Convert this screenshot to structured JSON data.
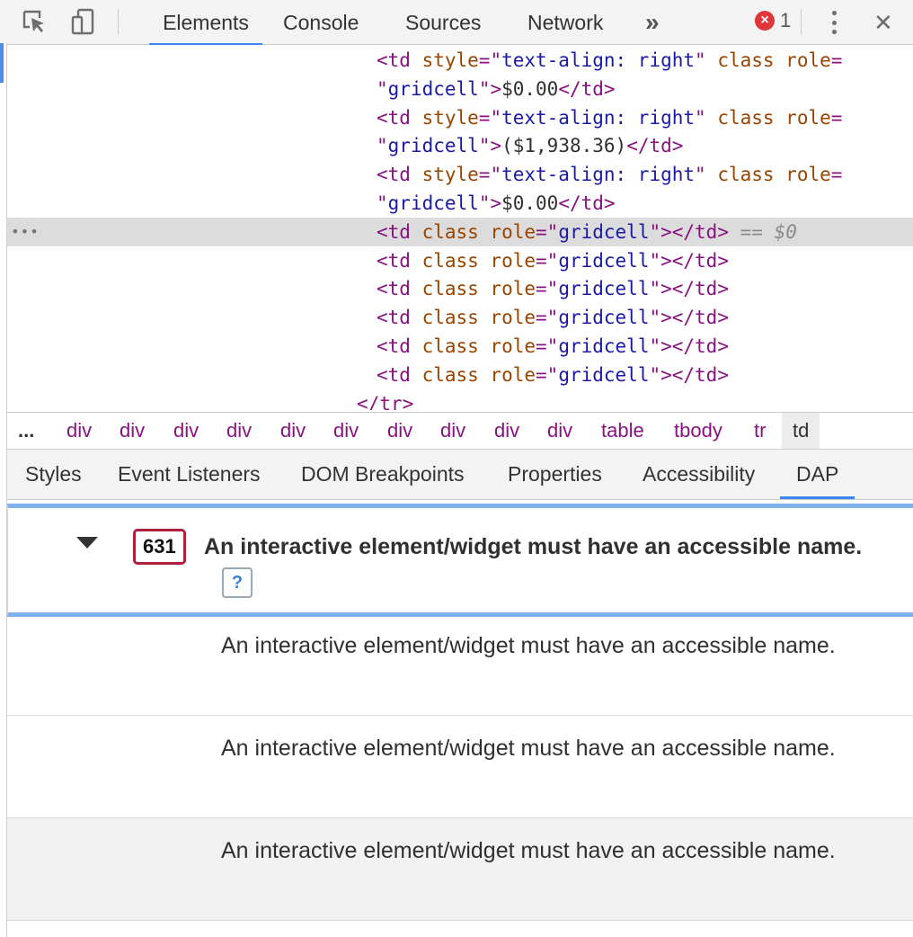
{
  "toolbar": {
    "icons": [
      "inspect-element-icon",
      "device-toolbar-icon"
    ],
    "tabs": [
      "Elements",
      "Console",
      "Sources",
      "Network"
    ],
    "more_tabs_glyph": "»",
    "error_count": "1",
    "error_glyph": "×",
    "close_glyph": "✕"
  },
  "dom": {
    "lines": [
      {
        "indent": true,
        "parts": [
          [
            "tag",
            "<td "
          ],
          [
            "attr",
            "style"
          ],
          [
            "tag",
            "=\""
          ],
          [
            "val",
            "text-align: right"
          ],
          [
            "tag",
            "\" "
          ],
          [
            "attr",
            "class role"
          ],
          [
            "tag",
            "="
          ]
        ]
      },
      {
        "parts": [
          [
            "tag",
            "\""
          ],
          [
            "val",
            "gridcell"
          ],
          [
            "tag",
            "\">"
          ],
          [
            "txt",
            "$0.00"
          ],
          [
            "tag",
            "</td>"
          ]
        ]
      },
      {
        "parts": [
          [
            "tag",
            "<td "
          ],
          [
            "attr",
            "style"
          ],
          [
            "tag",
            "=\""
          ],
          [
            "val",
            "text-align: right"
          ],
          [
            "tag",
            "\" "
          ],
          [
            "attr",
            "class role"
          ],
          [
            "tag",
            "="
          ]
        ]
      },
      {
        "parts": [
          [
            "tag",
            "\""
          ],
          [
            "val",
            "gridcell"
          ],
          [
            "tag",
            "\">"
          ],
          [
            "txt",
            "($1,938.36)"
          ],
          [
            "tag",
            "</td>"
          ]
        ]
      },
      {
        "parts": [
          [
            "tag",
            "<td "
          ],
          [
            "attr",
            "style"
          ],
          [
            "tag",
            "=\""
          ],
          [
            "val",
            "text-align: right"
          ],
          [
            "tag",
            "\" "
          ],
          [
            "attr",
            "class role"
          ],
          [
            "tag",
            "="
          ]
        ]
      },
      {
        "parts": [
          [
            "tag",
            "\""
          ],
          [
            "val",
            "gridcell"
          ],
          [
            "tag",
            "\">"
          ],
          [
            "txt",
            "$0.00"
          ],
          [
            "tag",
            "</td>"
          ]
        ]
      },
      {
        "selected": true,
        "parts": [
          [
            "tag",
            "<td "
          ],
          [
            "attr",
            "class role"
          ],
          [
            "tag",
            "=\""
          ],
          [
            "val",
            "gridcell"
          ],
          [
            "tag",
            "\"></td>"
          ]
        ],
        "suffix": " == $0"
      },
      {
        "parts": [
          [
            "tag",
            "<td "
          ],
          [
            "attr",
            "class role"
          ],
          [
            "tag",
            "=\""
          ],
          [
            "val",
            "gridcell"
          ],
          [
            "tag",
            "\"></td>"
          ]
        ]
      },
      {
        "parts": [
          [
            "tag",
            "<td "
          ],
          [
            "attr",
            "class role"
          ],
          [
            "tag",
            "=\""
          ],
          [
            "val",
            "gridcell"
          ],
          [
            "tag",
            "\"></td>"
          ]
        ]
      },
      {
        "parts": [
          [
            "tag",
            "<td "
          ],
          [
            "attr",
            "class role"
          ],
          [
            "tag",
            "=\""
          ],
          [
            "val",
            "gridcell"
          ],
          [
            "tag",
            "\"></td>"
          ]
        ]
      },
      {
        "parts": [
          [
            "tag",
            "<td "
          ],
          [
            "attr",
            "class role"
          ],
          [
            "tag",
            "=\""
          ],
          [
            "val",
            "gridcell"
          ],
          [
            "tag",
            "\"></td>"
          ]
        ]
      },
      {
        "parts": [
          [
            "tag",
            "<td "
          ],
          [
            "attr",
            "class role"
          ],
          [
            "tag",
            "=\""
          ],
          [
            "val",
            "gridcell"
          ],
          [
            "tag",
            "\"></td>"
          ]
        ]
      },
      {
        "close_tr": true,
        "parts": [
          [
            "tag",
            "</tr>"
          ]
        ]
      }
    ],
    "selected_marker": "==",
    "selected_var": "$0",
    "dots": "•••"
  },
  "breadcrumb": {
    "ellipsis": "...",
    "items": [
      "div",
      "div",
      "div",
      "div",
      "div",
      "div",
      "div",
      "div",
      "div",
      "div",
      "table",
      "tbody",
      "tr"
    ],
    "current": "td"
  },
  "subtabs": {
    "items": [
      "Styles",
      "Event Listeners",
      "DOM Breakpoints",
      "Properties",
      "Accessibility",
      "DAP"
    ],
    "active": "DAP"
  },
  "dap": {
    "rule_id": "631",
    "rule_title": "An interactive element/widget must have an accessible name.",
    "help_label": "?",
    "issues": [
      "An interactive element/widget must have an accessible name.",
      "An interactive element/widget must have an accessible name.",
      "An interactive element/widget must have an accessible name."
    ]
  },
  "colors": {
    "tag": "#881280",
    "attr": "#994500",
    "value": "#1a1aa6",
    "accent": "#3d85f0",
    "error": "#e0363b",
    "rule_badge_border": "#b01e3b"
  }
}
